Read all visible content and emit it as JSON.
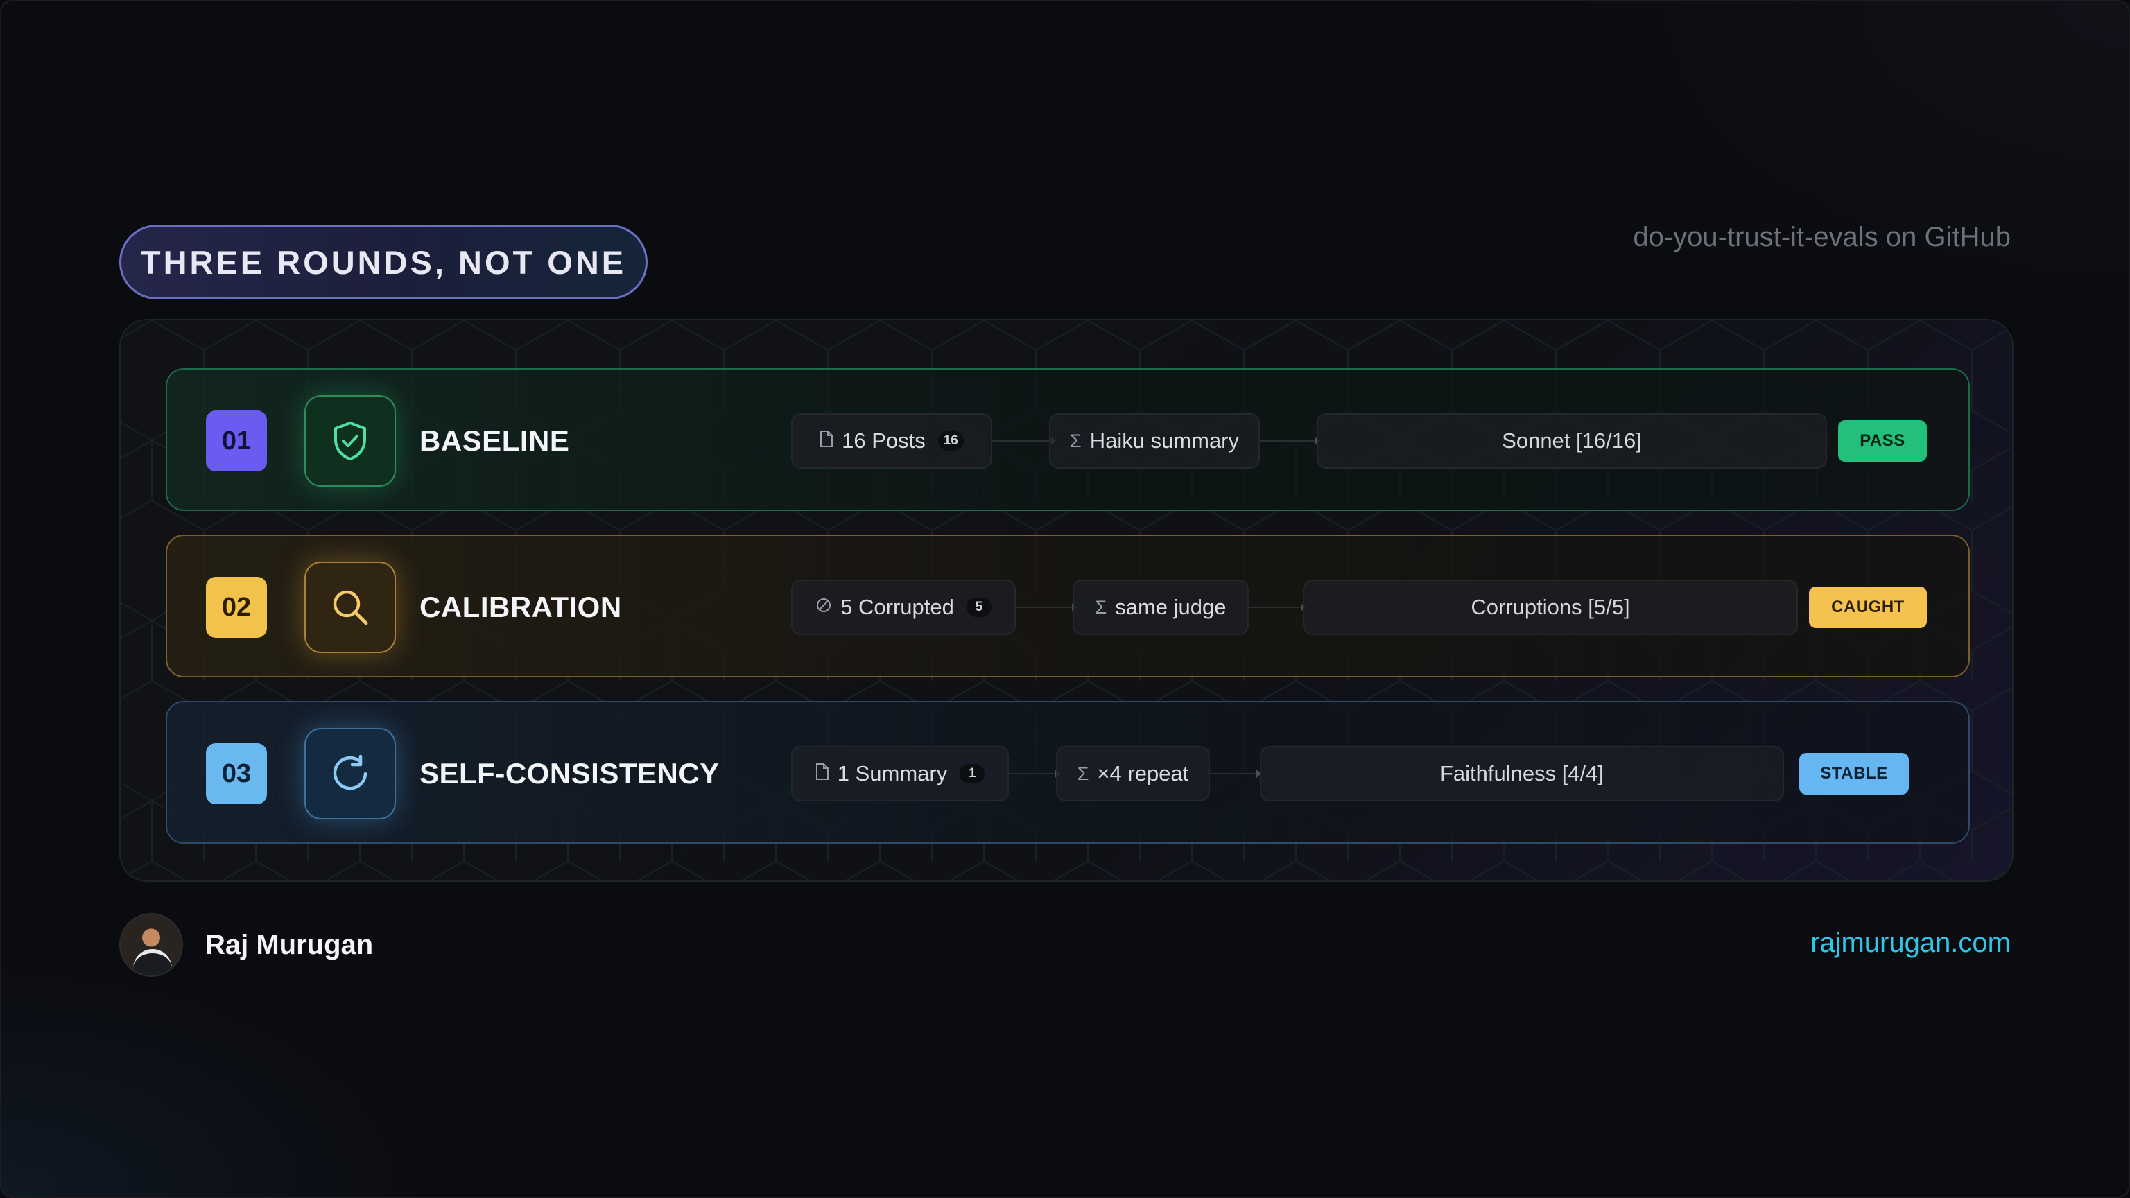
{
  "header": {
    "title": "THREE ROUNDS, NOT ONE",
    "repo_label": "do-you-trust-it-evals on GitHub"
  },
  "rounds": [
    {
      "number": "01",
      "title": "BASELINE",
      "icon": "shield-check-icon",
      "input": {
        "icon": "document-icon",
        "label": "16 Posts",
        "count": "16"
      },
      "process": {
        "icon": "sigma-icon",
        "label": "Haiku summary"
      },
      "result": "Sonnet [16/16]",
      "status": "PASS",
      "accent": "#22c07a"
    },
    {
      "number": "02",
      "title": "CALIBRATION",
      "icon": "search-icon",
      "input": {
        "icon": "prohibited-icon",
        "label": "5 Corrupted",
        "count": "5"
      },
      "process": {
        "icon": "sigma-icon",
        "label": "same judge"
      },
      "result": "Corruptions [5/5]",
      "status": "CAUGHT",
      "accent": "#f5c24f"
    },
    {
      "number": "03",
      "title": "SELF-CONSISTENCY",
      "icon": "refresh-icon",
      "input": {
        "icon": "document-icon",
        "label": "1 Summary",
        "count": "1"
      },
      "process": {
        "icon": "sigma-icon",
        "label": "×4 repeat"
      },
      "result": "Faithfulness [4/4]",
      "status": "STABLE",
      "accent": "#66b6f2"
    }
  ],
  "footer": {
    "author": "Raj Murugan",
    "website": "rajmurugan.com"
  },
  "glyphs": {
    "sigma": "Σ"
  }
}
